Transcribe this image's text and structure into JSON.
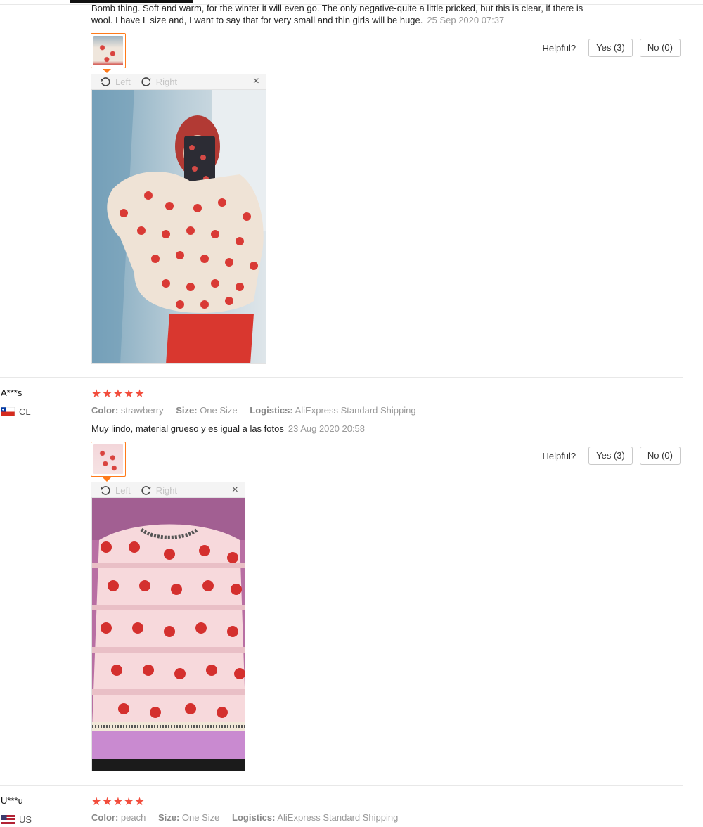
{
  "review1": {
    "text": "Bomb thing. Soft and warm, for the winter it will even go. The only negative-quite a little pricked, but this is clear, if there is wool. I have L size and, I want to say that for very small and thin girls will be huge.",
    "date": "25 Sep 2020 07:37",
    "helpful_label": "Helpful?",
    "yes_label": "Yes (3)",
    "no_label": "No (0)",
    "rotate_left_label": "Left",
    "rotate_right_label": "Right",
    "close_glyph": "×"
  },
  "review2": {
    "user": "A***s",
    "country": "CL",
    "stars": "★★★★★",
    "color_key": "Color:",
    "color_val": "strawberry",
    "size_key": "Size:",
    "size_val": "One Size",
    "logistics_key": "Logistics:",
    "logistics_val": "AliExpress Standard Shipping",
    "text": "Muy lindo, material grueso y es igual a las fotos",
    "date": "23 Aug 2020 20:58",
    "helpful_label": "Helpful?",
    "yes_label": "Yes (3)",
    "no_label": "No (0)",
    "rotate_left_label": "Left",
    "rotate_right_label": "Right",
    "close_glyph": "×"
  },
  "review3": {
    "user": "U***u",
    "country": "US",
    "stars": "★★★★★",
    "color_key": "Color:",
    "color_val": "peach",
    "size_key": "Size:",
    "size_val": "One Size",
    "logistics_key": "Logistics:",
    "logistics_val": "AliExpress Standard Shipping"
  },
  "icons": {
    "rotate_left": "rotate-left-icon",
    "rotate_right": "rotate-right-icon",
    "close": "close-icon",
    "star": "star-icon"
  },
  "colors": {
    "accent_orange": "#ff7a1a",
    "star_red": "#f24d3c",
    "muted_text": "#999999"
  }
}
